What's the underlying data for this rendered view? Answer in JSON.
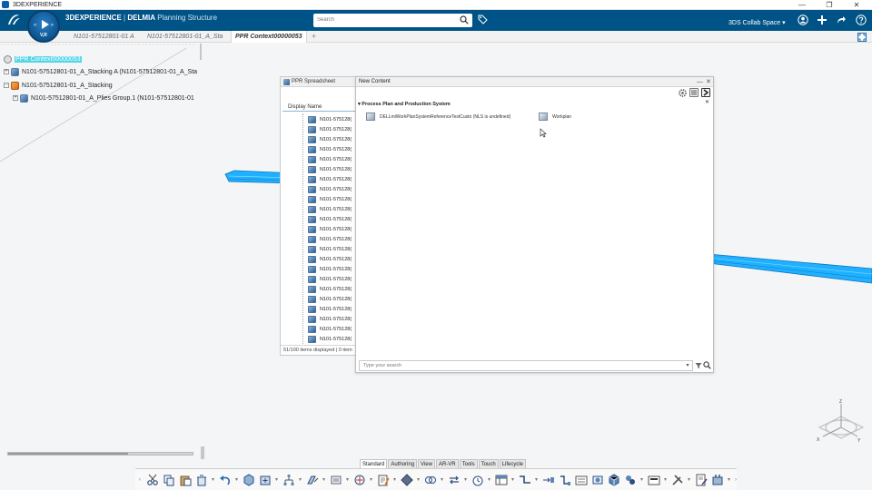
{
  "window": {
    "title": "3DEXPERIENCE",
    "min": "—",
    "restore": "❐",
    "close": "✕"
  },
  "app": {
    "brand": "3DEXPERIENCE",
    "separator": " | ",
    "product": "DELMIA",
    "module": " Planning Structure",
    "compass_label": "V,R"
  },
  "search": {
    "placeholder": "Search"
  },
  "header": {
    "collab_space": "3DS Collab Space",
    "collab_caret": "▾"
  },
  "tabs": [
    {
      "label": "N101-57512801-01 A"
    },
    {
      "label": "N101-57512801-01_A_Sta"
    },
    {
      "label": "PPR Context00000053"
    }
  ],
  "tab_add": "+",
  "tree": {
    "root": "PPR Context00000053",
    "items": [
      {
        "label": "N101-57512801-01_A_Stacking A (N101-57512801-01_A_Sta"
      },
      {
        "label": "N101-57512801-01_A_Stacking"
      },
      {
        "label": "N101-57512801-01_A_Plies Group.1 (N101-57512801-01"
      }
    ]
  },
  "ppr": {
    "title": "PPR Spreadsheet",
    "column": "Display Name",
    "row_label": "N101-575128(",
    "row_count": 23,
    "footer": "51/100 items displayed | 0 item"
  },
  "new_content": {
    "title": "New Content",
    "section": "Process Plan and Production System",
    "items": [
      {
        "label": "DELLmiWorkPlanSystemReferenceTestCusto (NLS is undefined)"
      },
      {
        "label": "Workplan"
      }
    ],
    "search_placeholder": "Type your search"
  },
  "axes": {
    "z": "Z",
    "x": "X",
    "y": "Y"
  },
  "action_tabs": [
    {
      "label": "Standard",
      "active": true
    },
    {
      "label": "Authoring",
      "active": false
    },
    {
      "label": "View",
      "active": false
    },
    {
      "label": "AR-VR",
      "active": false
    },
    {
      "label": "Tools",
      "active": false
    },
    {
      "label": "Touch",
      "active": false
    },
    {
      "label": "Lifecycle",
      "active": false
    }
  ],
  "colors": {
    "header_blue": "#005386",
    "selection": "#52d5e8",
    "geometry_cyan": "#1fb1ff"
  }
}
